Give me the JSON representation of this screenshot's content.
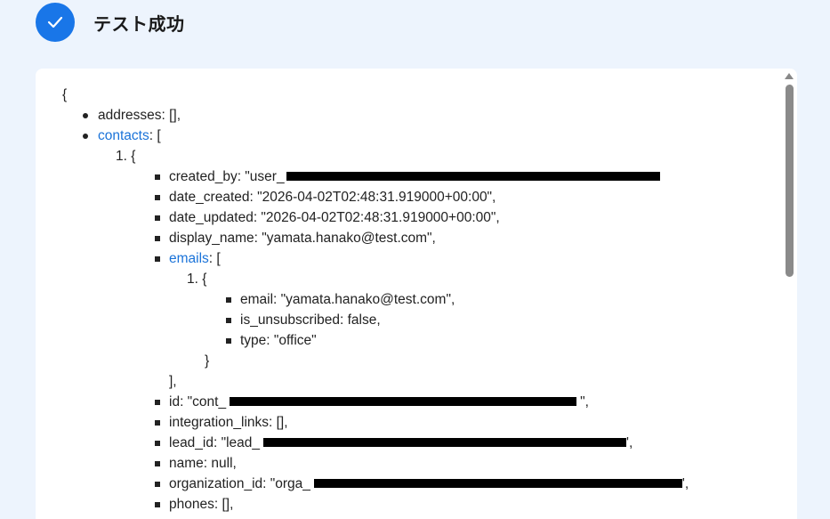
{
  "header": {
    "title": "テスト成功",
    "icon": "check-icon",
    "accent": "#1976e8"
  },
  "json_view": {
    "open_brace": "{",
    "addresses": "addresses: [],",
    "contacts_key": "contacts",
    "contacts_open": ": [",
    "item1_label": "1. {",
    "created_by": "created_by: \"user_",
    "date_created": "date_created: \"2026-04-02T02:48:31.919000+00:00\",",
    "date_updated": "date_updated: \"2026-04-02T02:48:31.919000+00:00\",",
    "display_name": "display_name: \"yamata.hanako@test.com\",",
    "emails_key": "emails",
    "emails_open": ": [",
    "email_item_label": "1. {",
    "email": "email: \"yamata.hanako@test.com\",",
    "is_unsubscribed": "is_unsubscribed: false,",
    "type": "type: \"office\"",
    "email_item_close": "}",
    "emails_close": "],",
    "id_prefix": "id: \"cont_",
    "id_suffix": "\",",
    "integration_links": "integration_links: [],",
    "lead_id_prefix": "lead_id: \"lead_",
    "lead_id_suffix": "',",
    "name": "name: null,",
    "organization_id_prefix": "organization_id: \"orga_",
    "organization_id_suffix": "',",
    "phones": "phones: [],"
  }
}
